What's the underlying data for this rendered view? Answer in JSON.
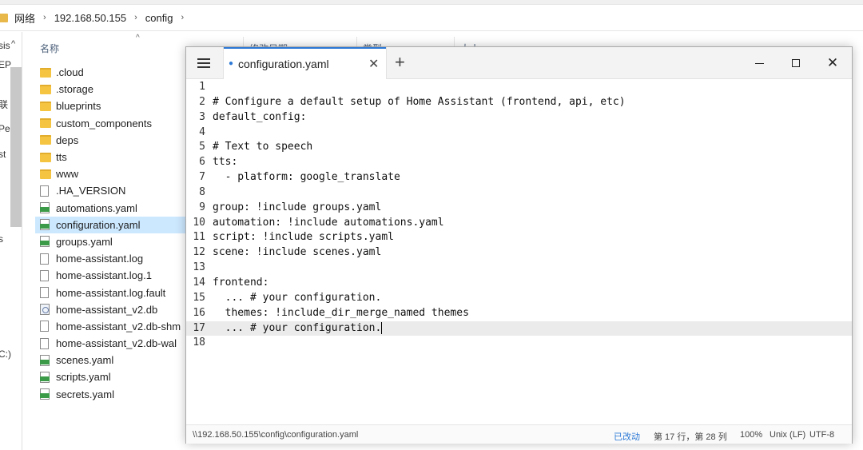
{
  "explorer": {
    "breadcrumb": [
      "网络",
      "192.168.50.155",
      "config"
    ],
    "columns": {
      "name": "名称",
      "modified": "修改日期",
      "type": "类型",
      "size": "大小"
    },
    "nav_fragments": [
      "sis",
      "EP",
      "联",
      "Pe",
      "st",
      "s",
      "C:)"
    ],
    "files": [
      {
        "name": ".cloud",
        "icon": "folder-icon"
      },
      {
        "name": ".storage",
        "icon": "folder-icon"
      },
      {
        "name": "blueprints",
        "icon": "folder-icon"
      },
      {
        "name": "custom_components",
        "icon": "folder-icon"
      },
      {
        "name": "deps",
        "icon": "folder-icon"
      },
      {
        "name": "tts",
        "icon": "folder-icon"
      },
      {
        "name": "www",
        "icon": "folder-icon"
      },
      {
        "name": ".HA_VERSION",
        "icon": "file-icon"
      },
      {
        "name": "automations.yaml",
        "icon": "yaml-file-icon"
      },
      {
        "name": "configuration.yaml",
        "icon": "yaml-file-icon",
        "selected": true
      },
      {
        "name": "groups.yaml",
        "icon": "yaml-file-icon"
      },
      {
        "name": "home-assistant.log",
        "icon": "file-icon"
      },
      {
        "name": "home-assistant.log.1",
        "icon": "file-icon"
      },
      {
        "name": "home-assistant.log.fault",
        "icon": "file-icon"
      },
      {
        "name": "home-assistant_v2.db",
        "icon": "db-file-icon"
      },
      {
        "name": "home-assistant_v2.db-shm",
        "icon": "file-icon"
      },
      {
        "name": "home-assistant_v2.db-wal",
        "icon": "file-icon"
      },
      {
        "name": "scenes.yaml",
        "icon": "yaml-file-icon"
      },
      {
        "name": "scripts.yaml",
        "icon": "yaml-file-icon"
      },
      {
        "name": "secrets.yaml",
        "icon": "yaml-file-icon"
      }
    ]
  },
  "editor": {
    "tab_title": "configuration.yaml",
    "current_line": 17,
    "lines": [
      "",
      "# Configure a default setup of Home Assistant (frontend, api, etc)",
      "default_config:",
      "",
      "# Text to speech",
      "tts:",
      "  - platform: google_translate",
      "",
      "group: !include groups.yaml",
      "automation: !include automations.yaml",
      "script: !include scripts.yaml",
      "scene: !include scenes.yaml",
      "",
      "frontend:",
      "  ... # your configuration.",
      "  themes: !include_dir_merge_named themes",
      "  ... # your configuration.",
      ""
    ],
    "status": {
      "path": "\\\\192.168.50.155\\config\\configuration.yaml",
      "modified": "已改动",
      "position": "第 17 行，第 28 列",
      "zoom": "100%",
      "eol": "Unix (LF)",
      "encoding": "UTF-8"
    }
  }
}
